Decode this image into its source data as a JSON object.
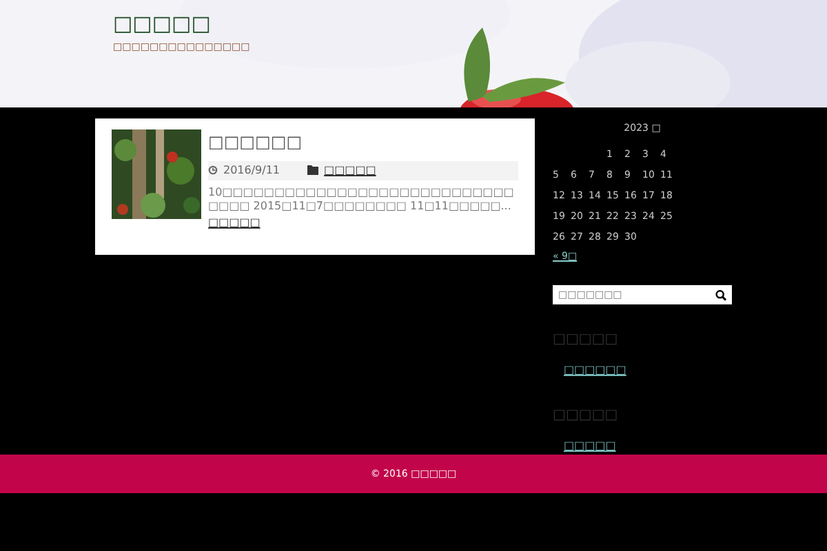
{
  "site": {
    "title": "□□□□□",
    "tagline": "□□□□□□□□□□□□□□□"
  },
  "post": {
    "title": "□□□□□□",
    "date": "2016/9/11",
    "category": "□□□□□",
    "excerpt": "10□□□□□□□□□□□□□□□□□□□□□□□□□□□□□□□□ 2015□11□7□□□□□□□□ 11□11□□□□□...",
    "more": "□□□□□"
  },
  "calendar": {
    "caption": "2023 □",
    "rows": [
      [
        "",
        "",
        "",
        "1",
        "2",
        "3",
        "4"
      ],
      [
        "5",
        "6",
        "7",
        "8",
        "9",
        "10",
        "11"
      ],
      [
        "12",
        "13",
        "14",
        "15",
        "16",
        "17",
        "18"
      ],
      [
        "19",
        "20",
        "21",
        "22",
        "23",
        "24",
        "25"
      ],
      [
        "26",
        "27",
        "28",
        "29",
        "30",
        "",
        ""
      ]
    ],
    "prev": "« 9□"
  },
  "search": {
    "placeholder": "□□□□□□□"
  },
  "widgets": [
    {
      "title": "□□□□□",
      "link": "□□□□□□"
    },
    {
      "title": "□□□□□",
      "link": "□□□□□"
    }
  ],
  "footer": {
    "text": "© 2016 □□□□□"
  }
}
